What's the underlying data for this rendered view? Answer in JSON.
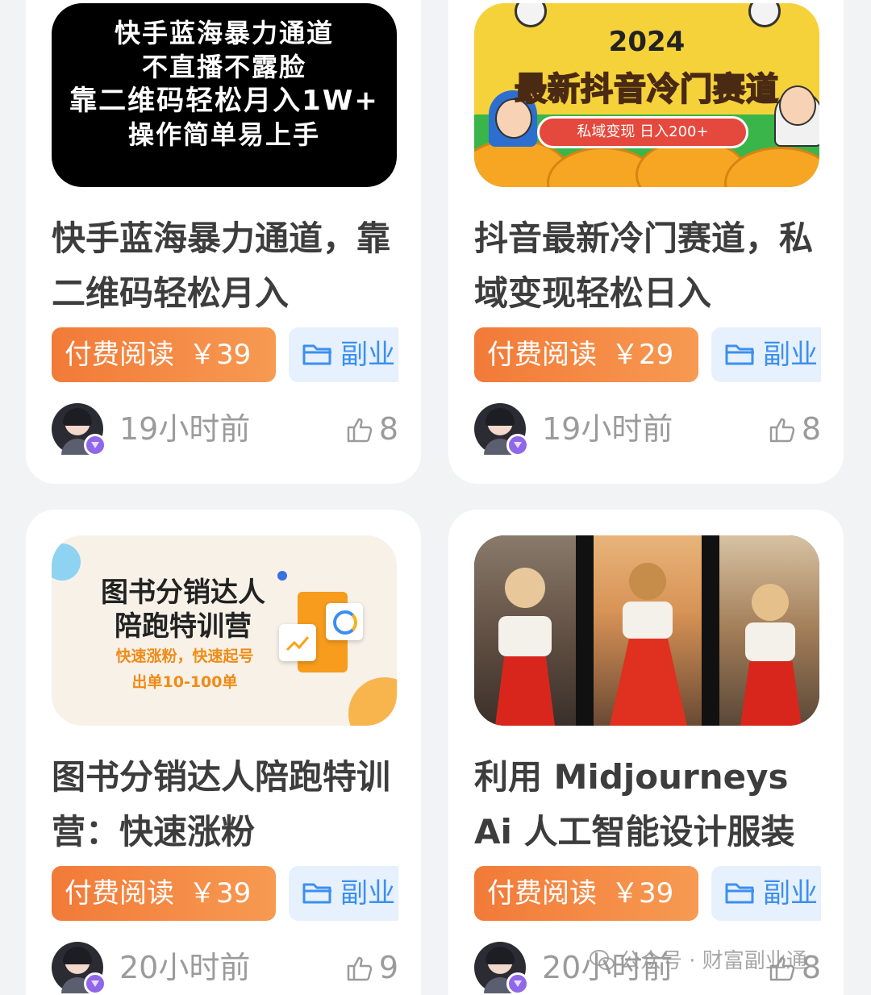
{
  "cards": [
    {
      "thumb_lines": [
        "快手蓝海暴力通道",
        "不直播不露脸",
        "靠二维码轻松月入1W+",
        "操作简单易上手"
      ],
      "title": "快手蓝海暴力通道，靠二维码轻松月入",
      "price_label": "付费阅读",
      "price": "￥39",
      "category": "副业",
      "time": "19小时前",
      "likes": "8"
    },
    {
      "thumb_year": "2024",
      "thumb_headline": "最新抖音冷门赛道",
      "thumb_pill": "私域变现 日入200+",
      "title": "抖音最新冷门赛道，私域变现轻松日入",
      "price_label": "付费阅读",
      "price": "￥29",
      "category": "副业",
      "time": "19小时前",
      "likes": "8"
    },
    {
      "thumb_lines": [
        "图书分销达人",
        "陪跑特训营"
      ],
      "thumb_sub": [
        "快速涨粉，快速起号",
        "出单10-100单"
      ],
      "title": "图书分销达人陪跑特训营：快速涨粉",
      "price_label": "付费阅读",
      "price": "￥39",
      "category": "副业",
      "time": "20小时前",
      "likes": "9"
    },
    {
      "title": "利用 Midjourneys Ai 人工智能设计服装",
      "price_label": "付费阅读",
      "price": "￥39",
      "category": "副业",
      "time": "20小时前",
      "likes": "8"
    }
  ],
  "watermark": "公众号 · 财富副业通",
  "colors": {
    "price_gradient_start": "#f27a38",
    "price_gradient_end": "#f79a52",
    "category_bg": "#e6f1fd",
    "category_text": "#3c8ff0",
    "avatar_badge": "#8f67e8"
  },
  "icons": [
    "folder-icon",
    "thumbs-up-icon",
    "vip-badge-icon",
    "wechat-icon"
  ]
}
